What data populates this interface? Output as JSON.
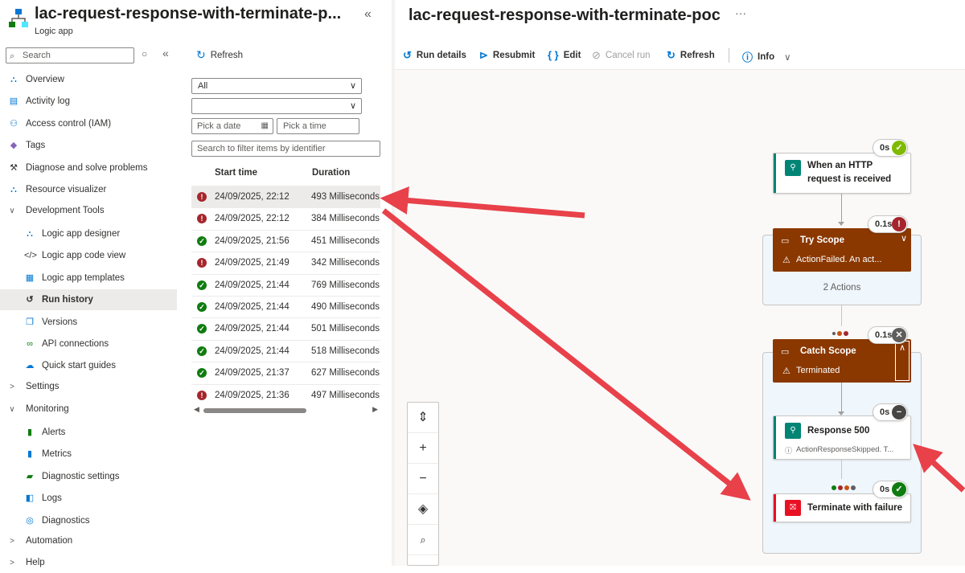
{
  "app": {
    "title": "lac-request-response-with-terminate-p...",
    "type": "Logic app",
    "collapse": "«"
  },
  "search": {
    "placeholder": "Search",
    "opt": "○",
    "collapse": "«"
  },
  "nav": [
    {
      "label": "Overview",
      "icon": "overview-icon",
      "glyph": "⛬",
      "color": "#0078d4"
    },
    {
      "label": "Activity log",
      "icon": "activity-log-icon",
      "glyph": "▤",
      "color": "#0078d4"
    },
    {
      "label": "Access control (IAM)",
      "icon": "people-icon",
      "glyph": "⚇",
      "color": "#0078d4"
    },
    {
      "label": "Tags",
      "icon": "tag-icon",
      "glyph": "◆",
      "color": "#8764b8"
    },
    {
      "label": "Diagnose and solve problems",
      "icon": "wrench-icon",
      "glyph": "⚒",
      "color": "#323130"
    },
    {
      "label": "Resource visualizer",
      "icon": "hierarchy-icon",
      "glyph": "⛬",
      "color": "#0078d4"
    },
    {
      "label": "Development Tools",
      "icon": "chevron-down-icon",
      "glyph": "∨",
      "group": true
    },
    {
      "label": "Logic app designer",
      "icon": "designer-icon",
      "glyph": "⛬",
      "color": "#0078d4",
      "sub": true
    },
    {
      "label": "Logic app code view",
      "icon": "code-icon",
      "glyph": "</>",
      "color": "#323130",
      "sub": true
    },
    {
      "label": "Logic app templates",
      "icon": "template-icon",
      "glyph": "▦",
      "color": "#0078d4",
      "sub": true
    },
    {
      "label": "Run history",
      "icon": "history-icon",
      "glyph": "↺",
      "color": "#323130",
      "sub": true,
      "active": true
    },
    {
      "label": "Versions",
      "icon": "versions-icon",
      "glyph": "❐",
      "color": "#0078d4",
      "sub": true
    },
    {
      "label": "API connections",
      "icon": "link-icon",
      "glyph": "∞",
      "color": "#107c10",
      "sub": true
    },
    {
      "label": "Quick start guides",
      "icon": "cloud-icon",
      "glyph": "☁",
      "color": "#0078d4",
      "sub": true
    },
    {
      "label": "Settings",
      "icon": "chevron-right-icon",
      "glyph": ">",
      "group": true
    },
    {
      "label": "Monitoring",
      "icon": "chevron-down-icon",
      "glyph": "∨",
      "group": true
    },
    {
      "label": "Alerts",
      "icon": "alert-icon",
      "glyph": "▮",
      "color": "#107c10",
      "sub": true
    },
    {
      "label": "Metrics",
      "icon": "metrics-icon",
      "glyph": "▮",
      "color": "#0078d4",
      "sub": true
    },
    {
      "label": "Diagnostic settings",
      "icon": "diagnostic-settings-icon",
      "glyph": "▰",
      "color": "#107c10",
      "sub": true
    },
    {
      "label": "Logs",
      "icon": "logs-icon",
      "glyph": "◧",
      "color": "#0078d4",
      "sub": true
    },
    {
      "label": "Diagnostics",
      "icon": "diagnostics-icon",
      "glyph": "◎",
      "color": "#0078d4",
      "sub": true
    },
    {
      "label": "Automation",
      "icon": "chevron-right-icon",
      "glyph": ">",
      "group": true
    },
    {
      "label": "Help",
      "icon": "chevron-right-icon",
      "glyph": ">",
      "group": true
    }
  ],
  "runs_panel": {
    "refresh": "Refresh",
    "status_filter": "All",
    "second_filter": "",
    "date_placeholder": "Pick a date",
    "time_placeholder": "Pick a time",
    "filter_placeholder": "Search to filter items by identifier",
    "col_start": "Start time",
    "col_duration": "Duration",
    "rows": [
      {
        "status": "failed",
        "start": "24/09/2025, 22:12",
        "duration": "493 Milliseconds",
        "selected": true
      },
      {
        "status": "failed",
        "start": "24/09/2025, 22:12",
        "duration": "384 Milliseconds"
      },
      {
        "status": "ok",
        "start": "24/09/2025, 21:56",
        "duration": "451 Milliseconds"
      },
      {
        "status": "failed",
        "start": "24/09/2025, 21:49",
        "duration": "342 Milliseconds"
      },
      {
        "status": "ok",
        "start": "24/09/2025, 21:44",
        "duration": "769 Milliseconds"
      },
      {
        "status": "ok",
        "start": "24/09/2025, 21:44",
        "duration": "490 Milliseconds"
      },
      {
        "status": "ok",
        "start": "24/09/2025, 21:44",
        "duration": "501 Milliseconds"
      },
      {
        "status": "ok",
        "start": "24/09/2025, 21:44",
        "duration": "518 Milliseconds"
      },
      {
        "status": "ok",
        "start": "24/09/2025, 21:37",
        "duration": "627 Milliseconds"
      },
      {
        "status": "failed",
        "start": "24/09/2025, 21:36",
        "duration": "497 Milliseconds"
      }
    ]
  },
  "run": {
    "title": "lac-request-response-with-terminate-poc",
    "more": "···",
    "toolbar": {
      "run_details": "Run details",
      "resubmit": "Resubmit",
      "edit": "Edit",
      "cancel_run": "Cancel run",
      "refresh": "Refresh",
      "info": "Info"
    }
  },
  "flow": {
    "trigger": {
      "title_line1": "When an HTTP",
      "title_line2": "request is received",
      "duration": "0s"
    },
    "try_scope": {
      "title": "Try Scope",
      "status": "ActionFailed. An act...",
      "duration": "0.1s",
      "summary": "2 Actions"
    },
    "catch_scope": {
      "title": "Catch Scope",
      "status": "Terminated",
      "duration": "0.1s"
    },
    "response": {
      "title": "Response 500",
      "status": "ActionResponseSkipped. T...",
      "duration": "0s"
    },
    "terminate": {
      "title": "Terminate with failure",
      "duration": "0s"
    }
  },
  "colors": {
    "accent": "#0078d4",
    "success": "#107c10",
    "failed": "#a4262c",
    "scope": "#8a3800",
    "annotation_arrow": "#e8414a"
  }
}
